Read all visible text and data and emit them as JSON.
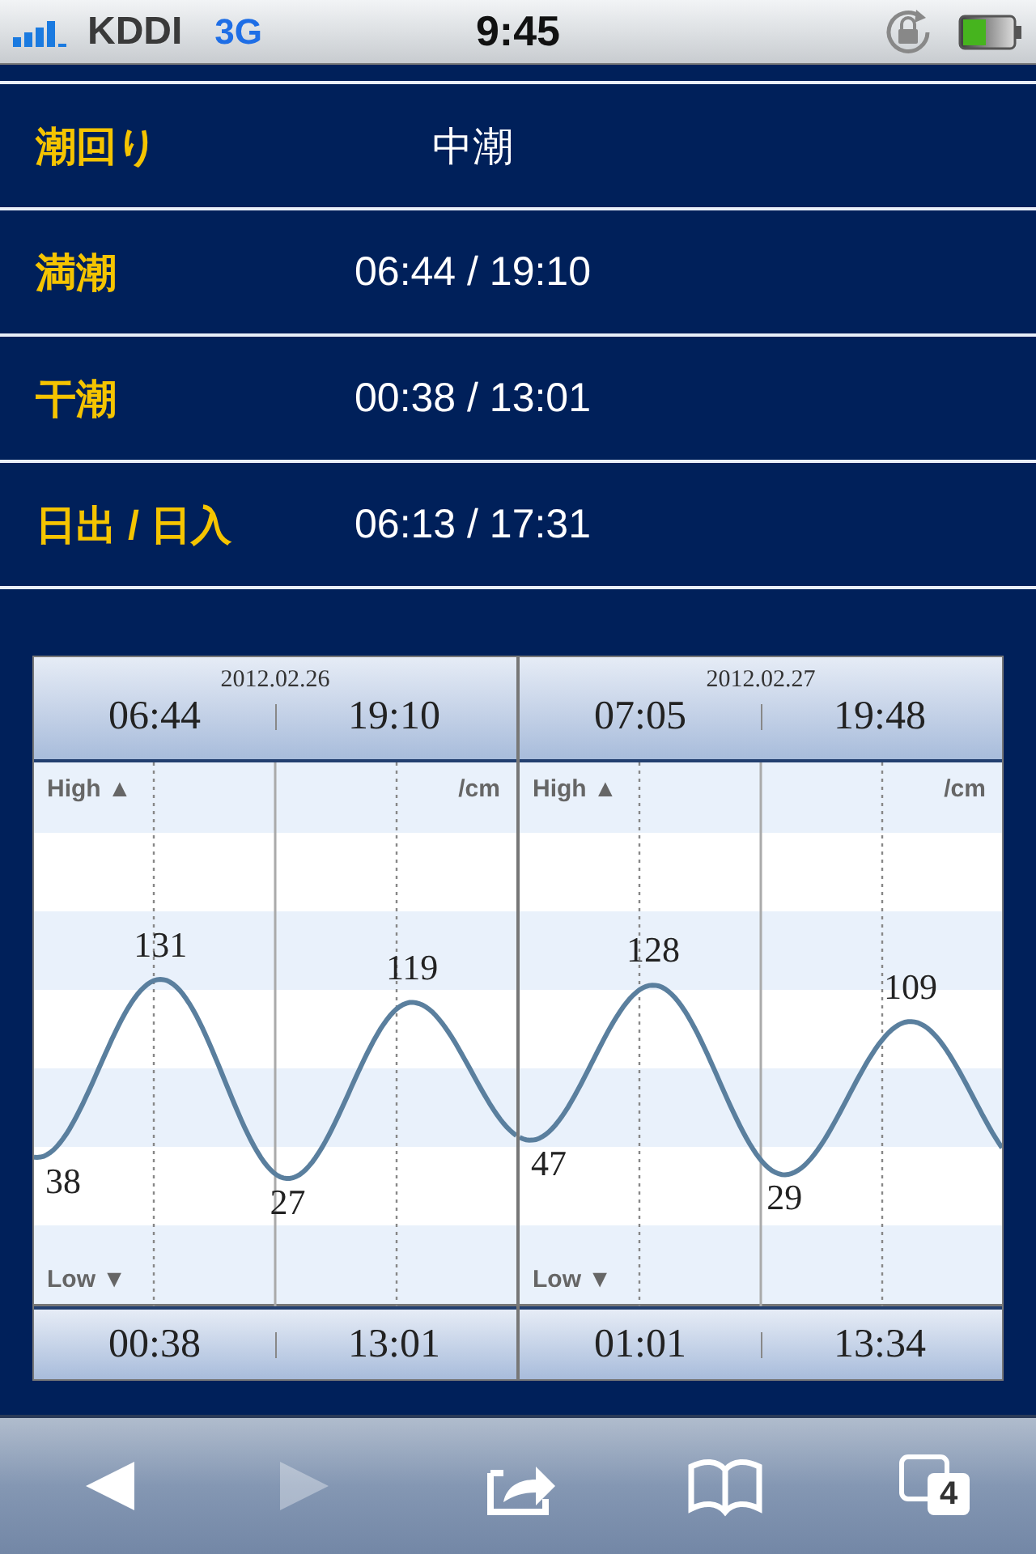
{
  "status_bar": {
    "carrier": "KDDI",
    "network": "3G",
    "time": "9:45"
  },
  "info_rows": [
    {
      "label": "潮回り",
      "value": "中潮"
    },
    {
      "label": "満潮",
      "value": "06:44 / 19:10"
    },
    {
      "label": "干潮",
      "value": "00:38 / 13:01"
    },
    {
      "label": "日出 / 日入",
      "value": "06:13 / 17:31"
    }
  ],
  "tide_chart": {
    "panels": [
      {
        "date": "2012.02.26",
        "high_times": [
          "06:44",
          "19:10"
        ],
        "low_times": [
          "00:38",
          "13:01"
        ],
        "high_values": [
          "131",
          "119"
        ],
        "low_values": [
          "38",
          "27"
        ],
        "high_label": "High ▲",
        "unit": "/cm",
        "low_label": "Low ▼"
      },
      {
        "date": "2012.02.27",
        "high_times": [
          "07:05",
          "19:48"
        ],
        "low_times": [
          "01:01",
          "13:34"
        ],
        "high_values": [
          "128",
          "109"
        ],
        "low_values": [
          "47",
          "29"
        ],
        "high_label": "High ▲",
        "unit": "/cm",
        "low_label": "Low ▼"
      }
    ]
  },
  "toolbar": {
    "back": {
      "disabled": false
    },
    "forward": {
      "disabled": true
    },
    "tab_count": "4"
  }
}
